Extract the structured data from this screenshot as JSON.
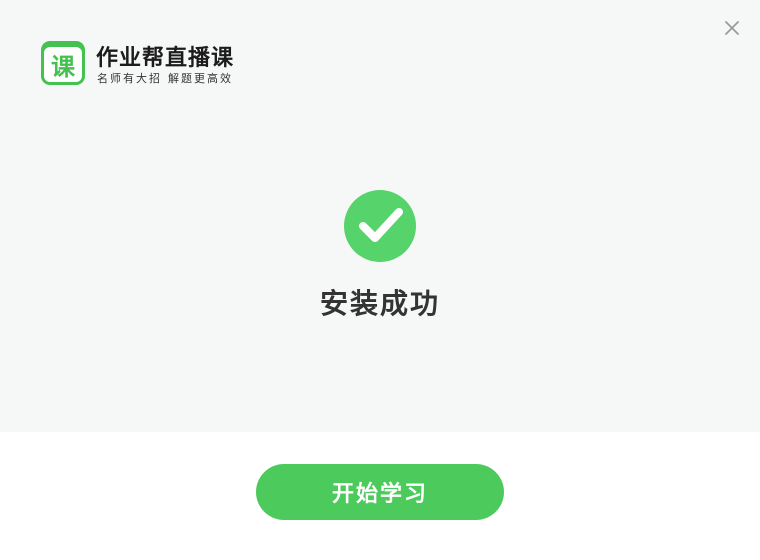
{
  "brand": {
    "badge_char": "课",
    "title": "作业帮直播课",
    "slogan_left": "名师有大招",
    "slogan_right": "解题更高效"
  },
  "status": {
    "message": "安装成功"
  },
  "actions": {
    "start_label": "开始学习",
    "close_icon": "close-icon"
  },
  "colors": {
    "accent": "#4ccb5c",
    "badge_green": "#44c24f",
    "check_green": "#56d36a",
    "top_background": "#f6f8f7",
    "bottom_background": "#ffffff",
    "text_dark": "#333333",
    "close_icon": "#9a9a9a"
  },
  "icons": {
    "success": "check-circle-icon",
    "close": "close-icon",
    "logo": "course-badge-icon"
  }
}
